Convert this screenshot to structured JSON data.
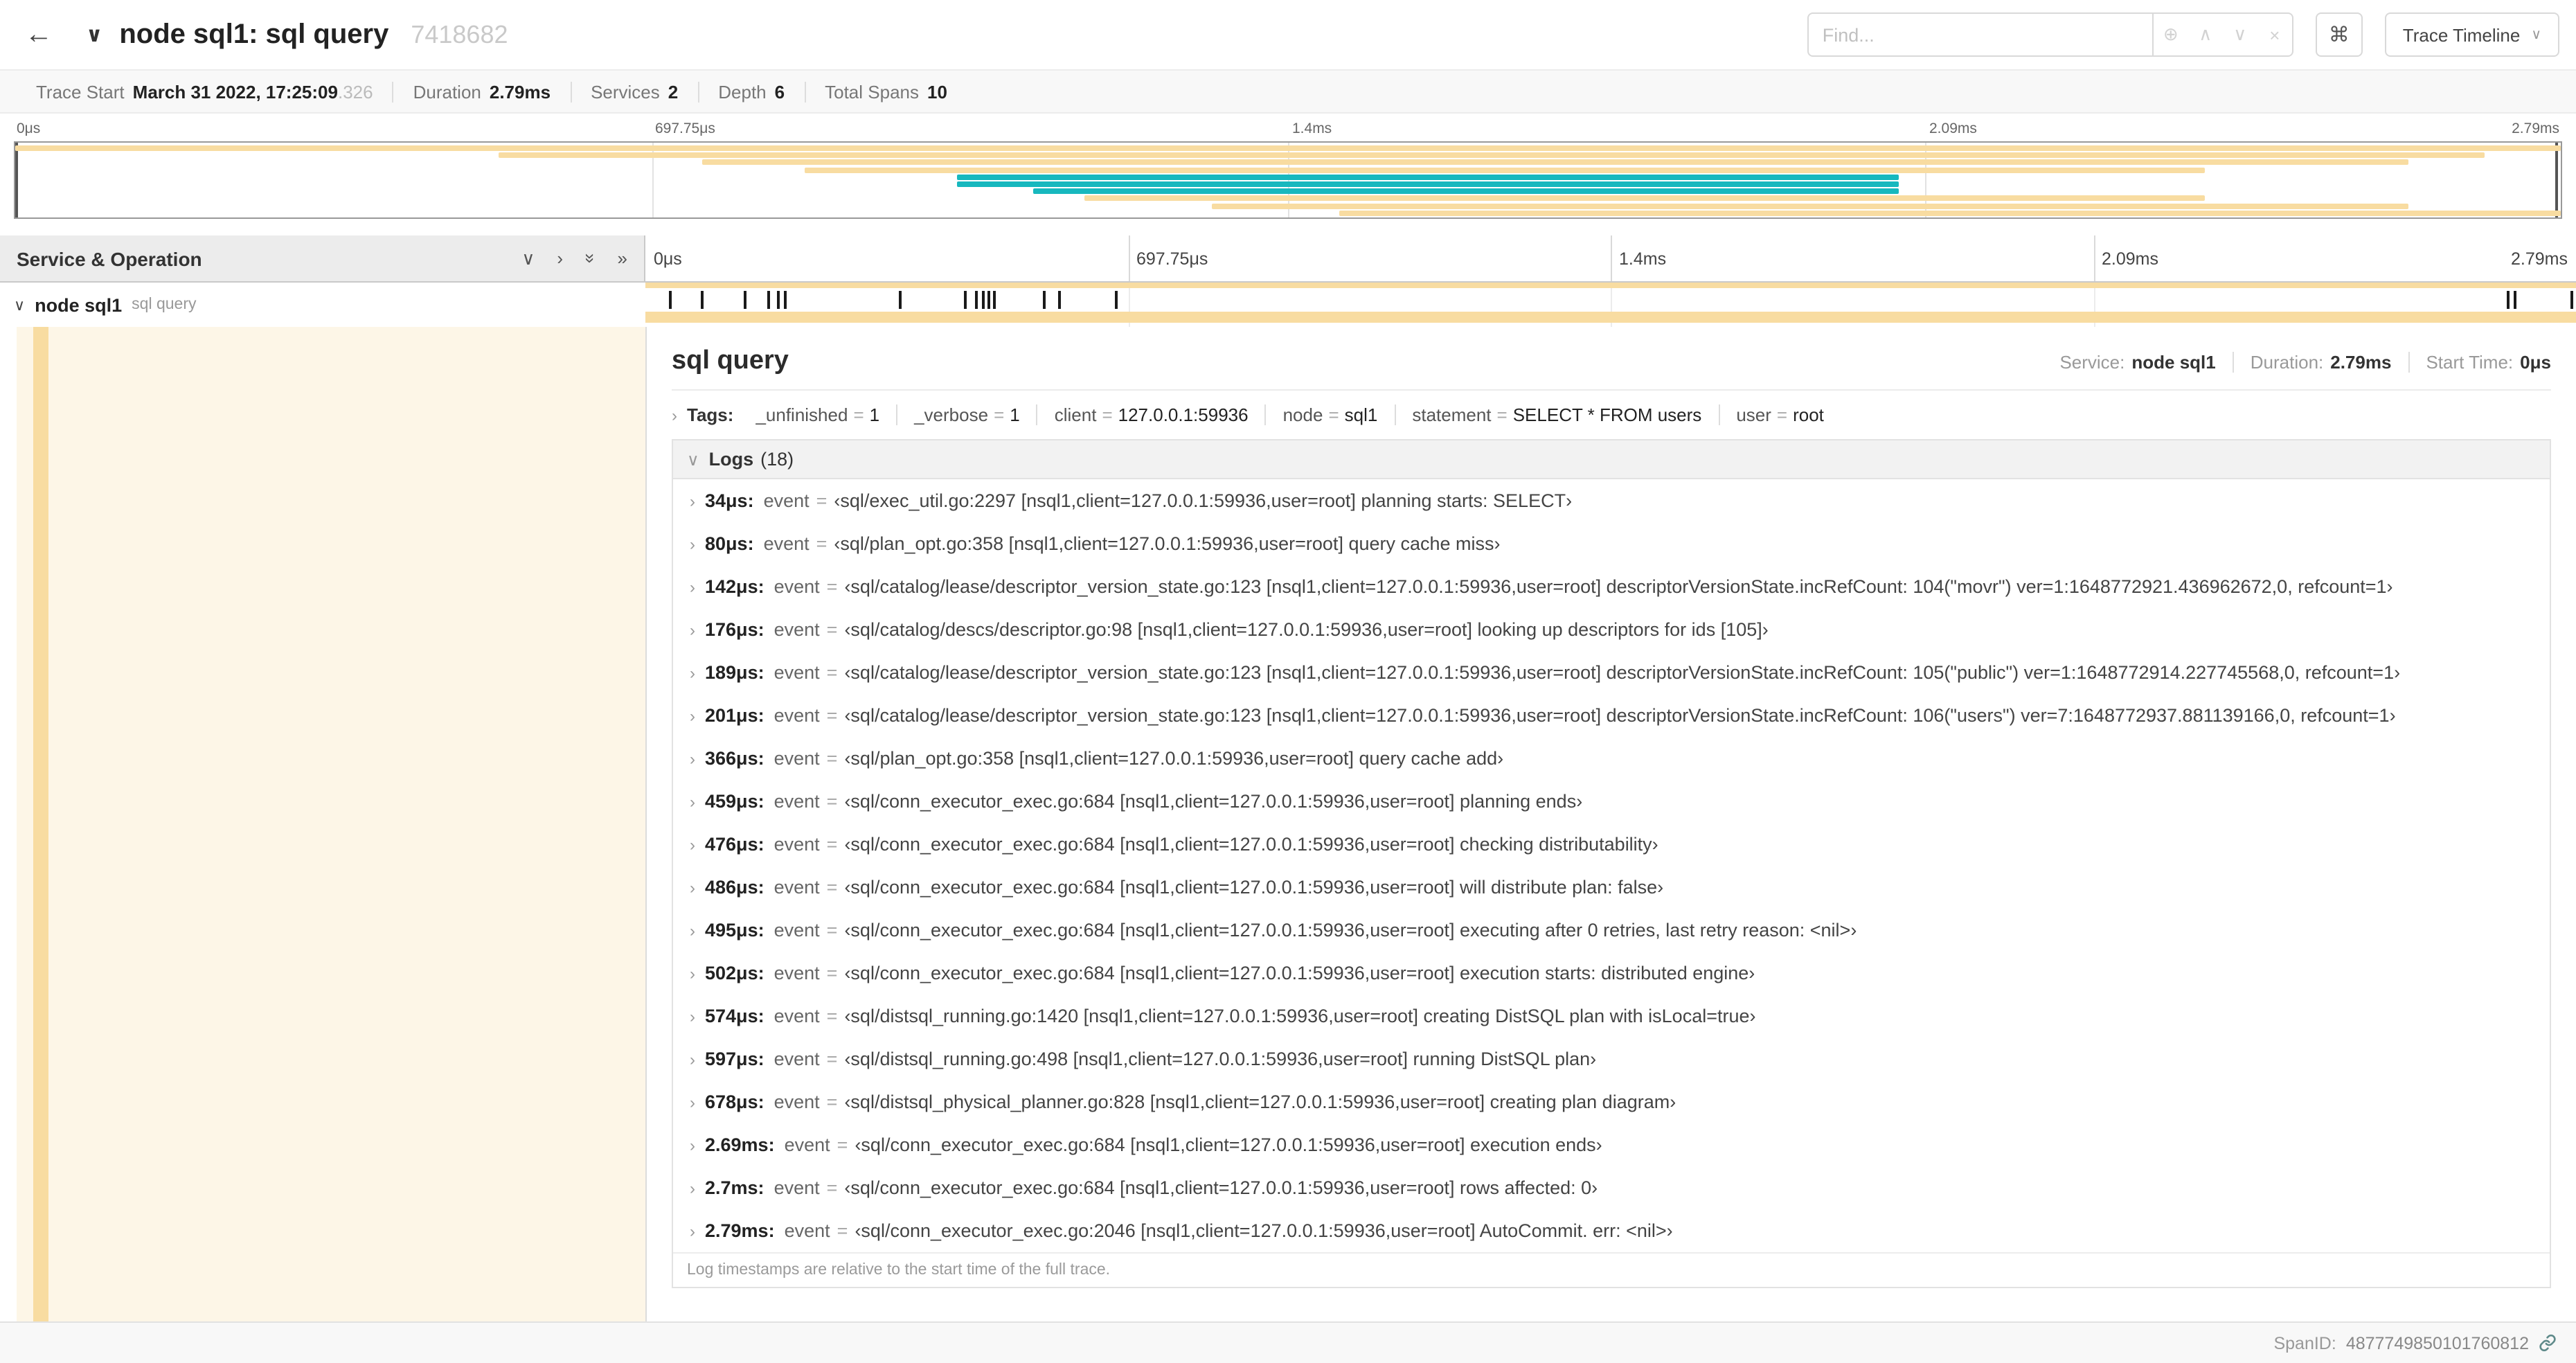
{
  "colors": {
    "tan": "#F8DCA1",
    "teal": "#17B8BE",
    "row_fill": "#F8DCA140"
  },
  "icons": {
    "back": "←",
    "chevron_down": "∨",
    "chevron_right": "›",
    "double_chevron": "»",
    "find_focus": "⊕",
    "prev_match": "∧",
    "next_match": "∨",
    "clear": "×",
    "command": "⌘"
  },
  "header": {
    "title": "node sql1: sql query",
    "trace_id": "7418682",
    "find_placeholder": "Find...",
    "view_selector": "Trace Timeline"
  },
  "summary": {
    "items": [
      {
        "label": "Trace Start",
        "value": "March 31 2022, 17:25:09",
        "suffix": ".326"
      },
      {
        "label": "Duration",
        "value": "2.79ms",
        "suffix": ""
      },
      {
        "label": "Services",
        "value": "2",
        "suffix": ""
      },
      {
        "label": "Depth",
        "value": "6",
        "suffix": ""
      },
      {
        "label": "Total Spans",
        "value": "10",
        "suffix": ""
      }
    ]
  },
  "minimap": {
    "axis_labels": [
      "0μs",
      "697.75μs",
      "1.4ms",
      "2.09ms",
      "2.79ms"
    ],
    "spans": [
      {
        "start": 0,
        "end": 100,
        "color": "tan"
      },
      {
        "start": 19,
        "end": 97,
        "color": "tan"
      },
      {
        "start": 27,
        "end": 94,
        "color": "tan"
      },
      {
        "start": 31,
        "end": 86,
        "color": "tan"
      },
      {
        "start": 37,
        "end": 74,
        "color": "teal"
      },
      {
        "start": 37,
        "end": 74,
        "color": "teal"
      },
      {
        "start": 40,
        "end": 74,
        "color": "teal"
      },
      {
        "start": 42,
        "end": 86,
        "color": "tan"
      },
      {
        "start": 47,
        "end": 94,
        "color": "tan"
      },
      {
        "start": 52,
        "end": 100,
        "color": "tan"
      }
    ]
  },
  "timeline": {
    "left_header": "Service & Operation",
    "axis_labels": [
      "0μs",
      "697.75μs",
      "1.4ms",
      "2.09ms",
      "2.79ms"
    ],
    "row": {
      "service": "node sql1",
      "operation": "sql query"
    },
    "ticks_pct": [
      1.2,
      2.9,
      5.1,
      6.3,
      6.8,
      7.2,
      13.1,
      16.5,
      17.1,
      17.4,
      17.7,
      18.0,
      20.6,
      21.4,
      24.3,
      96.4,
      96.8,
      99.7
    ]
  },
  "detail": {
    "title": "sql query",
    "meta": [
      {
        "label": "Service:",
        "value": "node sql1"
      },
      {
        "label": "Duration:",
        "value": "2.79ms"
      },
      {
        "label": "Start Time:",
        "value": "0μs"
      }
    ],
    "tags_label": "Tags:",
    "equals": "=",
    "log_key": "event",
    "tags": [
      {
        "key": "_unfinished",
        "value": "1"
      },
      {
        "key": "_verbose",
        "value": "1"
      },
      {
        "key": "client",
        "value": "127.0.0.1:59936"
      },
      {
        "key": "node",
        "value": "sql1"
      },
      {
        "key": "statement",
        "value": "SELECT * FROM users"
      },
      {
        "key": "user",
        "value": "root"
      }
    ],
    "logs_label": "Logs",
    "logs_count": "(18)",
    "logs": [
      {
        "time": "34μs:",
        "value": "‹sql/exec_util.go:2297 [nsql1,client=127.0.0.1:59936,user=root] planning starts: SELECT›"
      },
      {
        "time": "80μs:",
        "value": "‹sql/plan_opt.go:358 [nsql1,client=127.0.0.1:59936,user=root] query cache miss›"
      },
      {
        "time": "142μs:",
        "value": "‹sql/catalog/lease/descriptor_version_state.go:123 [nsql1,client=127.0.0.1:59936,user=root] descriptorVersionState.incRefCount: 104(\"movr\") ver=1:1648772921.436962672,0, refcount=1›"
      },
      {
        "time": "176μs:",
        "value": "‹sql/catalog/descs/descriptor.go:98 [nsql1,client=127.0.0.1:59936,user=root] looking up descriptors for ids [105]›"
      },
      {
        "time": "189μs:",
        "value": "‹sql/catalog/lease/descriptor_version_state.go:123 [nsql1,client=127.0.0.1:59936,user=root] descriptorVersionState.incRefCount: 105(\"public\") ver=1:1648772914.227745568,0, refcount=1›"
      },
      {
        "time": "201μs:",
        "value": "‹sql/catalog/lease/descriptor_version_state.go:123 [nsql1,client=127.0.0.1:59936,user=root] descriptorVersionState.incRefCount: 106(\"users\") ver=7:1648772937.881139166,0, refcount=1›"
      },
      {
        "time": "366μs:",
        "value": "‹sql/plan_opt.go:358 [nsql1,client=127.0.0.1:59936,user=root] query cache add›"
      },
      {
        "time": "459μs:",
        "value": "‹sql/conn_executor_exec.go:684 [nsql1,client=127.0.0.1:59936,user=root] planning ends›"
      },
      {
        "time": "476μs:",
        "value": "‹sql/conn_executor_exec.go:684 [nsql1,client=127.0.0.1:59936,user=root] checking distributability›"
      },
      {
        "time": "486μs:",
        "value": "‹sql/conn_executor_exec.go:684 [nsql1,client=127.0.0.1:59936,user=root] will distribute plan: false›"
      },
      {
        "time": "495μs:",
        "value": "‹sql/conn_executor_exec.go:684 [nsql1,client=127.0.0.1:59936,user=root] executing after 0 retries, last retry reason: <nil>›"
      },
      {
        "time": "502μs:",
        "value": "‹sql/conn_executor_exec.go:684 [nsql1,client=127.0.0.1:59936,user=root] execution starts: distributed engine›"
      },
      {
        "time": "574μs:",
        "value": "‹sql/distsql_running.go:1420 [nsql1,client=127.0.0.1:59936,user=root] creating DistSQL plan with isLocal=true›"
      },
      {
        "time": "597μs:",
        "value": "‹sql/distsql_running.go:498 [nsql1,client=127.0.0.1:59936,user=root] running DistSQL plan›"
      },
      {
        "time": "678μs:",
        "value": "‹sql/distsql_physical_planner.go:828 [nsql1,client=127.0.0.1:59936,user=root] creating plan diagram›"
      },
      {
        "time": "2.69ms:",
        "value": "‹sql/conn_executor_exec.go:684 [nsql1,client=127.0.0.1:59936,user=root] execution ends›"
      },
      {
        "time": "2.7ms:",
        "value": "‹sql/conn_executor_exec.go:684 [nsql1,client=127.0.0.1:59936,user=root] rows affected: 0›"
      },
      {
        "time": "2.79ms:",
        "value": "‹sql/conn_executor_exec.go:2046 [nsql1,client=127.0.0.1:59936,user=root] AutoCommit. err: <nil>›"
      }
    ],
    "footer_note": "Log timestamps are relative to the start time of the full trace.",
    "span_id_label": "SpanID:",
    "span_id": "4877749850101760812"
  }
}
